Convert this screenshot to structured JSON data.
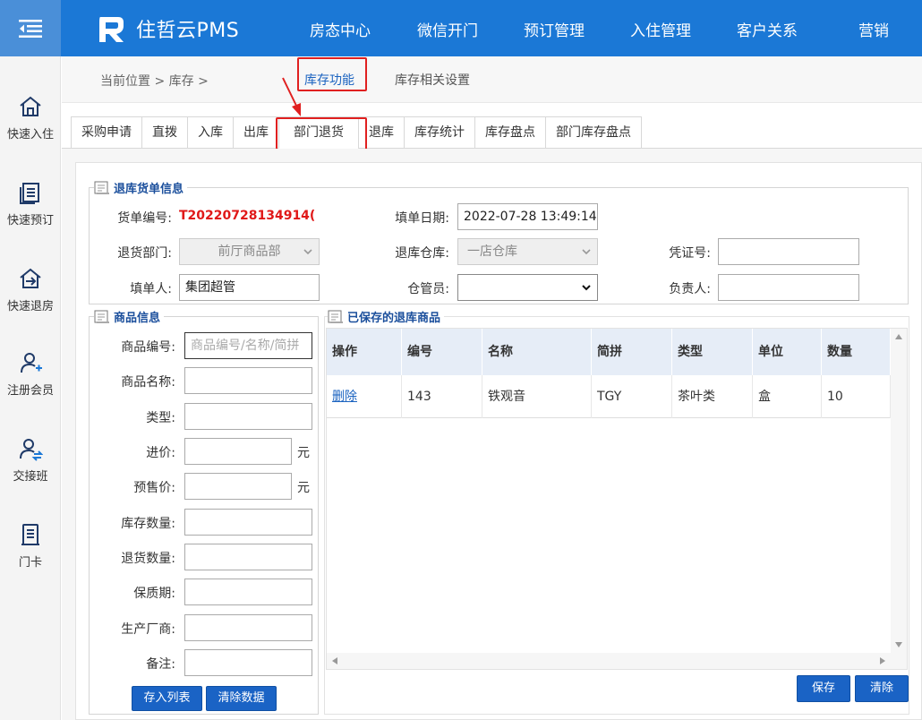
{
  "brand": {
    "name": "住哲云PMS"
  },
  "nav": [
    "房态中心",
    "微信开门",
    "预订管理",
    "入住管理",
    "客户关系",
    "营销"
  ],
  "sidebar": [
    {
      "label": "快速入住",
      "icon": "home-icon"
    },
    {
      "label": "快速预订",
      "icon": "document-icon"
    },
    {
      "label": "快速退房",
      "icon": "checkout-icon"
    },
    {
      "label": "注册会员",
      "icon": "add-user-icon"
    },
    {
      "label": "交接班",
      "icon": "shift-user-icon"
    },
    {
      "label": "门卡",
      "icon": "card-icon"
    }
  ],
  "breadcrumb": {
    "text": "当前位置 > 库存 >"
  },
  "top_tabs": [
    {
      "label": "库存功能",
      "active": true
    },
    {
      "label": "库存相关设置",
      "active": false
    }
  ],
  "sub_tabs": [
    "采购申请",
    "直拨",
    "入库",
    "出库",
    "部门退货",
    "退库",
    "库存统计",
    "库存盘点",
    "部门库存盘点"
  ],
  "sub_tab_active": "部门退货",
  "order_info": {
    "title": "退库货单信息",
    "order_no_label": "货单编号:",
    "order_no": "T20220728134914(",
    "fill_date_label": "填单日期:",
    "fill_date": "2022-07-28 13:49:14",
    "dept_label": "退货部门:",
    "dept": "前厅商品部",
    "warehouse_label": "退库仓库:",
    "warehouse": "一店仓库",
    "voucher_label": "凭证号:",
    "voucher": "",
    "filler_label": "填单人:",
    "filler": "集团超管",
    "keeper_label": "仓管员:",
    "keeper": "",
    "owner_label": "负责人:",
    "owner": ""
  },
  "goods_info": {
    "title": "商品信息",
    "fields": [
      {
        "label": "商品编号:",
        "value": "",
        "placeholder": "商品编号/名称/简拼"
      },
      {
        "label": "商品名称:",
        "value": ""
      },
      {
        "label": "类型:",
        "value": ""
      },
      {
        "label": "进价:",
        "value": "",
        "unit": "元"
      },
      {
        "label": "预售价:",
        "value": "",
        "unit": "元"
      },
      {
        "label": "库存数量:",
        "value": ""
      },
      {
        "label": "退货数量:",
        "value": ""
      },
      {
        "label": "保质期:",
        "value": ""
      },
      {
        "label": "生产厂商:",
        "value": ""
      },
      {
        "label": "备注:",
        "value": ""
      }
    ],
    "save_list_btn": "存入列表",
    "clear_data_btn": "清除数据"
  },
  "saved_goods": {
    "title": "已保存的退库商品",
    "columns": [
      "操作",
      "编号",
      "名称",
      "简拼",
      "类型",
      "单位",
      "数量"
    ],
    "rows": [
      {
        "action": "删除",
        "id": "143",
        "name": "铁观音",
        "abbr": "TGY",
        "type": "茶叶类",
        "unit": "盒",
        "qty": "10"
      }
    ]
  },
  "footer_buttons": {
    "save": "保存",
    "clear": "清除"
  },
  "colors": {
    "topbar": "#1b78d6",
    "accent": "#1a63c5",
    "highlight": "#e02020",
    "order_no": "#e01818"
  }
}
